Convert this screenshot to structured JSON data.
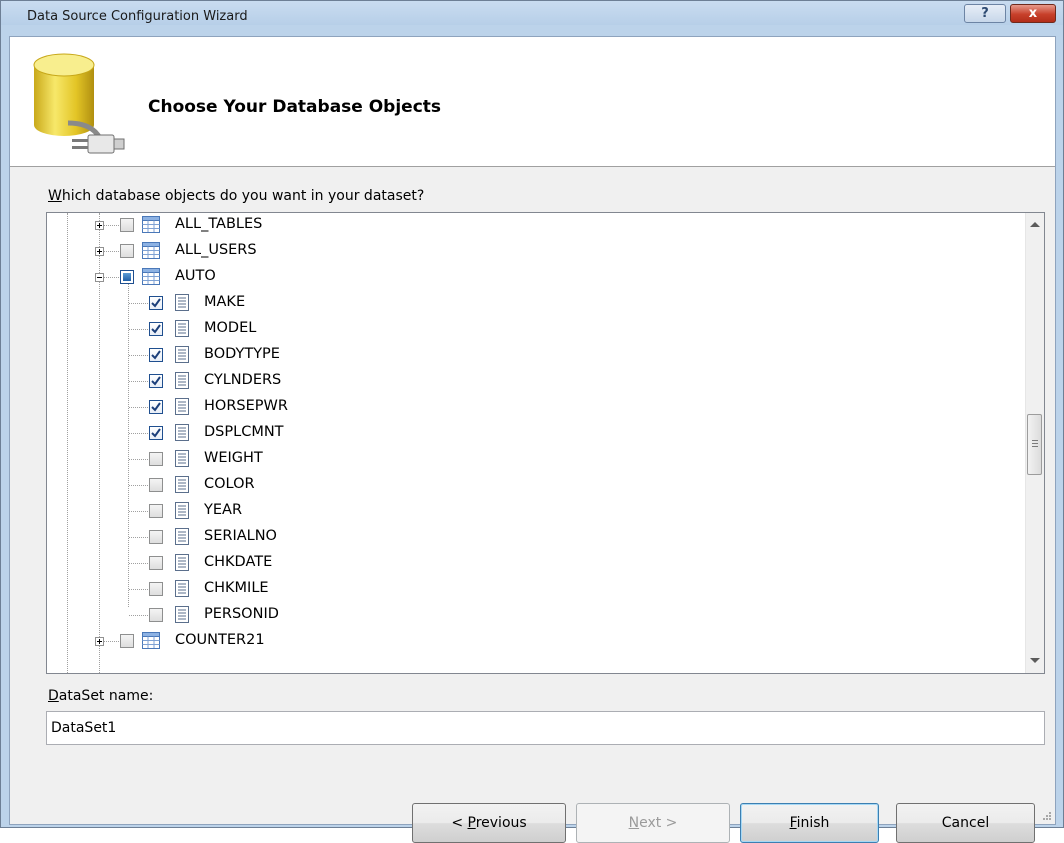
{
  "window": {
    "title": "Data Source Configuration Wizard",
    "help_label": "?",
    "close_label": "x"
  },
  "header": {
    "title": "Choose Your Database Objects"
  },
  "tree": {
    "prompt_key": "W",
    "prompt_rest": "hich database objects do you want in your dataset?",
    "items": [
      {
        "label": "ALL_TABLES",
        "kind": "table",
        "state": "unchecked",
        "expander": "plus"
      },
      {
        "label": "ALL_USERS",
        "kind": "table",
        "state": "unchecked",
        "expander": "plus"
      },
      {
        "label": "AUTO",
        "kind": "table",
        "state": "partial",
        "expander": "minus"
      },
      {
        "label": "MAKE",
        "kind": "column",
        "state": "checked"
      },
      {
        "label": "MODEL",
        "kind": "column",
        "state": "checked"
      },
      {
        "label": "BODYTYPE",
        "kind": "column",
        "state": "checked"
      },
      {
        "label": "CYLNDERS",
        "kind": "column",
        "state": "checked"
      },
      {
        "label": "HORSEPWR",
        "kind": "column",
        "state": "checked"
      },
      {
        "label": "DSPLCMNT",
        "kind": "column",
        "state": "checked"
      },
      {
        "label": "WEIGHT",
        "kind": "column",
        "state": "unchecked"
      },
      {
        "label": "COLOR",
        "kind": "column",
        "state": "unchecked"
      },
      {
        "label": "YEAR",
        "kind": "column",
        "state": "unchecked"
      },
      {
        "label": "SERIALNO",
        "kind": "column",
        "state": "unchecked"
      },
      {
        "label": "CHKDATE",
        "kind": "column",
        "state": "unchecked"
      },
      {
        "label": "CHKMILE",
        "kind": "column",
        "state": "unchecked"
      },
      {
        "label": "PERSONID",
        "kind": "column",
        "state": "unchecked"
      },
      {
        "label": "COUNTER21",
        "kind": "table",
        "state": "unchecked",
        "expander": "plus"
      }
    ]
  },
  "dataset": {
    "label_key": "D",
    "label_rest": "ataSet name:",
    "value": "DataSet1"
  },
  "buttons": {
    "previous_prefix": "< ",
    "previous_key": "P",
    "previous_rest": "revious",
    "next_key": "N",
    "next_rest": "ext >",
    "finish_key": "F",
    "finish_rest": "inish",
    "cancel": "Cancel"
  },
  "icons": {
    "db": "database-plug-icon",
    "table": "table-icon",
    "column": "column-icon"
  }
}
